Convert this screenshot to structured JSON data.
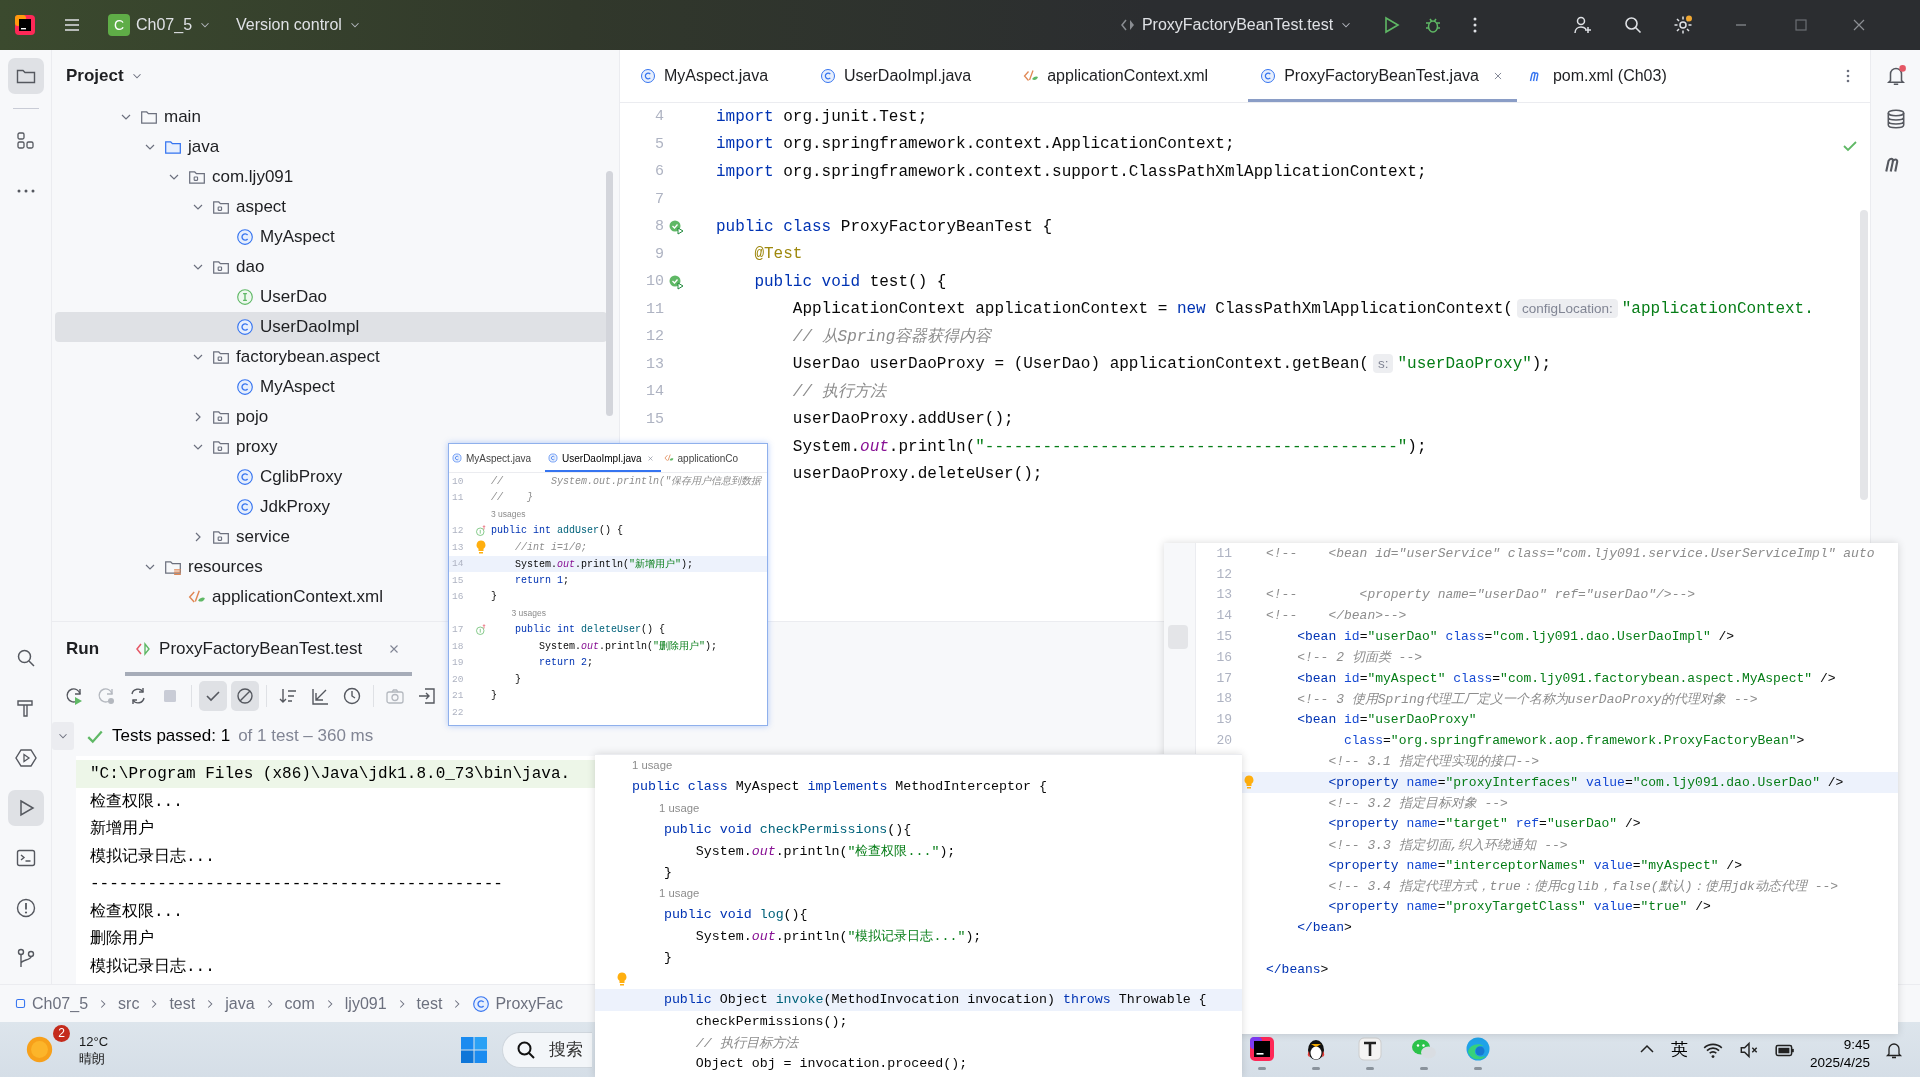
{
  "title_bar": {
    "project_badge": "C",
    "project": "Ch07_5",
    "vcs": "Version control",
    "run_config": "ProxyFactoryBeanTest.test"
  },
  "left_toolbar": {
    "top": [
      {
        "kind": "project",
        "selected": true
      },
      {
        "kind": "structure",
        "selected": false
      },
      {
        "kind": "more",
        "selected": false
      }
    ],
    "bottom": [
      {
        "kind": "search",
        "selected": false
      },
      {
        "kind": "build",
        "selected": false
      },
      {
        "kind": "services",
        "selected": false
      },
      {
        "kind": "run",
        "selected": true
      },
      {
        "kind": "terminal",
        "selected": false
      },
      {
        "kind": "problems",
        "selected": false
      },
      {
        "kind": "git",
        "selected": false
      }
    ]
  },
  "project_panel": {
    "title": "Project",
    "tree": [
      {
        "label": "main",
        "kind": "folder",
        "expanded": true,
        "selected": false,
        "children": [
          {
            "label": "java",
            "kind": "source_root",
            "expanded": true,
            "selected": false,
            "children": [
              {
                "label": "com.ljy091",
                "kind": "package",
                "expanded": true,
                "selected": false,
                "children": [
                  {
                    "label": "aspect",
                    "kind": "package",
                    "expanded": true,
                    "selected": false,
                    "children": [
                      {
                        "label": "MyAspect",
                        "kind": "class",
                        "selected": false
                      }
                    ]
                  },
                  {
                    "label": "dao",
                    "kind": "package",
                    "expanded": true,
                    "selected": false,
                    "children": [
                      {
                        "label": "UserDao",
                        "kind": "interface",
                        "selected": false
                      },
                      {
                        "label": "UserDaoImpl",
                        "kind": "class",
                        "selected": true
                      }
                    ]
                  },
                  {
                    "label": "factorybean.aspect",
                    "kind": "package",
                    "expanded": true,
                    "selected": false,
                    "children": [
                      {
                        "label": "MyAspect",
                        "kind": "class",
                        "selected": false
                      }
                    ]
                  },
                  {
                    "label": "pojo",
                    "kind": "package",
                    "expanded": false,
                    "selected": false
                  },
                  {
                    "label": "proxy",
                    "kind": "package",
                    "expanded": true,
                    "selected": false,
                    "children": [
                      {
                        "label": "CglibProxy",
                        "kind": "class",
                        "selected": false
                      },
                      {
                        "label": "JdkProxy",
                        "kind": "class",
                        "selected": false
                      }
                    ]
                  },
                  {
                    "label": "service",
                    "kind": "package",
                    "expanded": false,
                    "selected": false
                  }
                ]
              }
            ]
          },
          {
            "label": "resources",
            "kind": "resources",
            "expanded": true,
            "selected": false,
            "children": [
              {
                "label": "applicationContext.xml",
                "kind": "xml",
                "selected": false
              }
            ]
          }
        ]
      }
    ]
  },
  "editor": {
    "tabs": [
      {
        "label": "MyAspect.java",
        "kind": "class",
        "selected": false
      },
      {
        "label": "UserDaoImpl.java",
        "kind": "class",
        "selected": false
      },
      {
        "label": "applicationContext.xml",
        "kind": "xml",
        "selected": false
      },
      {
        "label": "ProxyFactoryBeanTest.java",
        "kind": "class",
        "selected": true
      },
      {
        "label": "pom.xml (Ch03)",
        "kind": "maven",
        "selected": false
      }
    ],
    "lines": [
      {
        "kind": "code",
        "number": "4",
        "current": false,
        "segments": [
          {
            "kind": "keyword",
            "text": "import"
          },
          {
            "kind": "plain",
            "text": " org.junit.Test;"
          }
        ]
      },
      {
        "kind": "code",
        "number": "5",
        "current": false,
        "segments": [
          {
            "kind": "keyword",
            "text": "import"
          },
          {
            "kind": "plain",
            "text": " org.springframework.context.ApplicationContext;"
          }
        ]
      },
      {
        "kind": "code",
        "number": "6",
        "current": false,
        "segments": [
          {
            "kind": "keyword",
            "text": "import"
          },
          {
            "kind": "plain",
            "text": " org.springframework.context.support.ClassPathXmlApplicationContext;"
          }
        ]
      },
      {
        "kind": "code",
        "number": "7",
        "current": false
      },
      {
        "kind": "code",
        "number": "8",
        "gutter": {
          "kind": "run"
        },
        "current": false,
        "segments": [
          {
            "kind": "keyword",
            "text": "public class"
          },
          {
            "kind": "plain",
            "text": " ProxyFactoryBeanTest {"
          }
        ]
      },
      {
        "kind": "code",
        "number": "9",
        "current": false,
        "segments": [
          {
            "kind": "annotation",
            "text": "    @Test"
          }
        ]
      },
      {
        "kind": "code",
        "number": "10",
        "gutter": {
          "kind": "run"
        },
        "current": false,
        "segments": [
          {
            "kind": "keyword",
            "text": "    public void"
          },
          {
            "kind": "plain",
            "text": " test() {"
          }
        ]
      },
      {
        "kind": "code",
        "number": "11",
        "current": false,
        "segments": [
          {
            "kind": "plain",
            "text": "        ApplicationContext applicationContext = "
          },
          {
            "kind": "keyword",
            "text": "new"
          },
          {
            "kind": "plain",
            "text": " ClassPathXmlApplicationContext("
          },
          {
            "kind": "hint",
            "text": "configLocation:"
          },
          {
            "kind": "string",
            "text": "\"applicationContext."
          }
        ]
      },
      {
        "kind": "code",
        "number": "12",
        "current": false,
        "segments": [
          {
            "kind": "comment",
            "text": "        // 从Spring容器获得内容"
          }
        ]
      },
      {
        "kind": "code",
        "number": "13",
        "current": false,
        "segments": [
          {
            "kind": "plain",
            "text": "        UserDao userDaoProxy = (UserDao) applicationContext.getBean("
          },
          {
            "kind": "hint",
            "text": "s:"
          },
          {
            "kind": "string",
            "text": "\"userDaoProxy\""
          },
          {
            "kind": "plain",
            "text": ");"
          }
        ]
      },
      {
        "kind": "code",
        "number": "14",
        "current": false,
        "segments": [
          {
            "kind": "comment",
            "text": "        // 执行方法"
          }
        ]
      },
      {
        "kind": "code",
        "number": "15",
        "current": false,
        "segments": [
          {
            "kind": "plain",
            "text": "        userDaoProxy.addUser();"
          }
        ]
      },
      {
        "kind": "code",
        "current": false,
        "segments": [
          {
            "kind": "plain",
            "text": "        System."
          },
          {
            "kind": "field",
            "text": "out"
          },
          {
            "kind": "plain",
            "text": ".println("
          },
          {
            "kind": "string",
            "text": "\"-------------------------------------------\""
          },
          {
            "kind": "plain",
            "text": ");"
          }
        ]
      },
      {
        "kind": "code",
        "current": false,
        "segments": [
          {
            "kind": "plain",
            "text": "        userDaoProxy.deleteUser();"
          }
        ]
      }
    ]
  },
  "run_panel": {
    "title": "Run",
    "tab": {
      "label": "ProxyFactoryBeanTest.test",
      "selected": true
    },
    "toolbar": [
      {
        "kind": "rerun",
        "selected": false,
        "disabled": false
      },
      {
        "kind": "rerun_failed",
        "selected": false,
        "disabled": true
      },
      {
        "kind": "toggle_auto",
        "selected": false,
        "disabled": false
      },
      {
        "kind": "stop",
        "selected": false,
        "disabled": true
      },
      {
        "kind": "show_passed",
        "selected": true,
        "disabled": false
      },
      {
        "kind": "show_ignored",
        "selected": true,
        "disabled": false
      },
      {
        "kind": "sort",
        "selected": false,
        "disabled": false
      },
      {
        "kind": "import",
        "selected": false,
        "disabled": false
      },
      {
        "kind": "history",
        "selected": false,
        "disabled": false
      },
      {
        "kind": "screenshot",
        "selected": false,
        "disabled": true
      },
      {
        "kind": "export",
        "selected": false,
        "disabled": false
      }
    ],
    "result": {
      "summary": "Tests passed: 1",
      "detail": "of 1 test – 360 ms"
    },
    "console": [
      {
        "kind": "command",
        "text": "\"C:\\Program Files (x86)\\Java\\jdk1.8.0_73\\bin\\java."
      },
      {
        "kind": "output",
        "text": "检查权限..."
      },
      {
        "kind": "output",
        "text": "新增用户"
      },
      {
        "kind": "output",
        "text": "模拟记录日志..."
      },
      {
        "kind": "output",
        "text": "-------------------------------------------"
      },
      {
        "kind": "output",
        "text": "检查权限..."
      },
      {
        "kind": "output",
        "text": "删除用户"
      },
      {
        "kind": "output",
        "text": "模拟记录日志..."
      }
    ]
  },
  "breadcrumb": [
    {
      "label": "Ch07_5",
      "kind": "module"
    },
    {
      "label": "src",
      "kind": "folder"
    },
    {
      "label": "test",
      "kind": "folder"
    },
    {
      "label": "java",
      "kind": "folder"
    },
    {
      "label": "com",
      "kind": "folder"
    },
    {
      "label": "ljy091",
      "kind": "folder"
    },
    {
      "label": "test",
      "kind": "folder"
    },
    {
      "label": "ProxyFac",
      "kind": "class"
    }
  ],
  "implementation_snippet": {
    "tabs": [
      {
        "label": "MyAspect.java",
        "kind": "class",
        "selected": false
      },
      {
        "label": "UserDaoImpl.java",
        "kind": "class",
        "selected": true
      },
      {
        "label": "applicationCo",
        "kind": "xml",
        "selected": false
      }
    ],
    "lines": [
      {
        "kind": "code",
        "number": "10",
        "current": false,
        "segments": [
          {
            "kind": "comment",
            "text": "//        System.out.println(\"保存用户信息到数据"
          }
        ]
      },
      {
        "kind": "code",
        "number": "11",
        "current": false,
        "segments": [
          {
            "kind": "comment",
            "text": "//    }"
          }
        ]
      },
      {
        "kind": "usage",
        "text": "3 usages"
      },
      {
        "kind": "code",
        "number": "12",
        "gutter": {
          "kind": "implements"
        },
        "current": false,
        "segments": [
          {
            "kind": "keyword",
            "text": "public int"
          },
          {
            "kind": "method",
            "text": " addUser"
          },
          {
            "kind": "plain",
            "text": "() {"
          }
        ]
      },
      {
        "kind": "code",
        "number": "13",
        "gutter": {
          "kind": "bulb"
        },
        "current": false,
        "segments": [
          {
            "kind": "comment",
            "text": "    //int i=1/0;"
          }
        ]
      },
      {
        "kind": "code",
        "number": "14",
        "current": true,
        "segments": [
          {
            "kind": "plain",
            "text": "    System."
          },
          {
            "kind": "field",
            "text": "out"
          },
          {
            "kind": "plain",
            "text": ".println("
          },
          {
            "kind": "string",
            "text": "\"新增用户\""
          },
          {
            "kind": "plain",
            "text": ");"
          }
        ]
      },
      {
        "kind": "code",
        "number": "15",
        "current": false,
        "segments": [
          {
            "kind": "keyword",
            "text": "    return"
          },
          {
            "kind": "keyword",
            "text": " 1"
          },
          {
            "kind": "plain",
            "text": ";"
          }
        ]
      },
      {
        "kind": "code",
        "number": "16",
        "current": false,
        "segments": [
          {
            "kind": "plain",
            "text": "}"
          }
        ]
      },
      {
        "kind": "usage",
        "text": "3 usages"
      },
      {
        "kind": "code",
        "number": "17",
        "gutter": {
          "kind": "implements"
        },
        "current": false,
        "segments": [
          {
            "kind": "keyword",
            "text": "    public int"
          },
          {
            "kind": "method",
            "text": " deleteUser"
          },
          {
            "kind": "plain",
            "text": "() {"
          }
        ]
      },
      {
        "kind": "code",
        "number": "18",
        "current": false,
        "segments": [
          {
            "kind": "plain",
            "text": "        System."
          },
          {
            "kind": "field",
            "text": "out"
          },
          {
            "kind": "plain",
            "text": ".println("
          },
          {
            "kind": "string",
            "text": "\"删除用户\""
          },
          {
            "kind": "plain",
            "text": ");"
          }
        ]
      },
      {
        "kind": "code",
        "number": "19",
        "current": false,
        "segments": [
          {
            "kind": "keyword",
            "text": "        return"
          },
          {
            "kind": "keyword",
            "text": " 2"
          },
          {
            "kind": "plain",
            "text": ";"
          }
        ]
      },
      {
        "kind": "code",
        "number": "20",
        "current": false,
        "segments": [
          {
            "kind": "plain",
            "text": "    }"
          }
        ]
      },
      {
        "kind": "code",
        "number": "21",
        "current": false,
        "segments": [
          {
            "kind": "plain",
            "text": "}"
          }
        ]
      },
      {
        "kind": "code",
        "number": "22",
        "current": false
      }
    ]
  },
  "xml_snippet": {
    "lines": [
      {
        "kind": "code",
        "number": "11",
        "current": false,
        "segments": [
          {
            "kind": "comment",
            "text": "<!--    <bean id=\"userService\" class=\"com.ljy091.service.UserServiceImpl\" auto"
          }
        ]
      },
      {
        "kind": "code",
        "number": "12",
        "current": false
      },
      {
        "kind": "code",
        "number": "13",
        "current": false,
        "segments": [
          {
            "kind": "comment",
            "text": "<!--        <property name=\"userDao\" ref=\"userDao\"/>-->"
          }
        ]
      },
      {
        "kind": "code",
        "number": "14",
        "current": false,
        "segments": [
          {
            "kind": "comment",
            "text": "<!--    </bean>-->"
          }
        ]
      },
      {
        "kind": "code",
        "number": "15",
        "current": false,
        "segments": [
          {
            "kind": "tag",
            "text": "    <bean"
          },
          {
            "kind": "attribute",
            "text": " id"
          },
          {
            "kind": "plain",
            "text": "="
          },
          {
            "kind": "value",
            "text": "\"userDao\""
          },
          {
            "kind": "attribute",
            "text": " class"
          },
          {
            "kind": "plain",
            "text": "="
          },
          {
            "kind": "value",
            "text": "\"com.ljy091.dao.UserDaoImpl\""
          },
          {
            "kind": "plain",
            "text": " />"
          }
        ]
      },
      {
        "kind": "code",
        "number": "16",
        "current": false,
        "segments": [
          {
            "kind": "comment",
            "text": "    <!-- 2 切面类 -->"
          }
        ]
      },
      {
        "kind": "code",
        "number": "17",
        "current": false,
        "segments": [
          {
            "kind": "tag",
            "text": "    <bean"
          },
          {
            "kind": "attribute",
            "text": " id"
          },
          {
            "kind": "plain",
            "text": "="
          },
          {
            "kind": "value",
            "text": "\"myAspect\""
          },
          {
            "kind": "attribute",
            "text": " class"
          },
          {
            "kind": "plain",
            "text": "="
          },
          {
            "kind": "value",
            "text": "\"com.ljy091.factorybean.aspect.MyAspect\""
          },
          {
            "kind": "plain",
            "text": " />"
          }
        ]
      },
      {
        "kind": "code",
        "number": "18",
        "current": false,
        "segments": [
          {
            "kind": "comment",
            "text": "    <!-- 3 使用Spring代理工厂定义一个名称为userDaoProxy的代理对象 -->"
          }
        ]
      },
      {
        "kind": "code",
        "number": "19",
        "current": false,
        "segments": [
          {
            "kind": "tag",
            "text": "    <bean"
          },
          {
            "kind": "attribute",
            "text": " id"
          },
          {
            "kind": "plain",
            "text": "="
          },
          {
            "kind": "value",
            "text": "\"userDaoProxy\""
          }
        ]
      },
      {
        "kind": "code",
        "number": "20",
        "current": false,
        "segments": [
          {
            "kind": "attribute",
            "text": "          class"
          },
          {
            "kind": "plain",
            "text": "="
          },
          {
            "kind": "value",
            "text": "\"org.springframework.aop.framework.ProxyFactoryBean\""
          },
          {
            "kind": "plain",
            "text": ">"
          }
        ]
      },
      {
        "kind": "code",
        "current": false,
        "segments": [
          {
            "kind": "comment",
            "text": "        <!-- 3.1 指定代理实现的接口-->"
          }
        ]
      },
      {
        "kind": "code",
        "gutter": {
          "kind": "bulb"
        },
        "current": true,
        "segments": [
          {
            "kind": "tag",
            "text": "        <property"
          },
          {
            "kind": "attribute",
            "text": " name"
          },
          {
            "kind": "plain",
            "text": "="
          },
          {
            "kind": "value",
            "text": "\"proxyInterfaces\""
          },
          {
            "kind": "attribute",
            "text": " value"
          },
          {
            "kind": "plain",
            "text": "="
          },
          {
            "kind": "value",
            "text": "\"com.ljy091.dao.UserDao\""
          },
          {
            "kind": "plain",
            "text": " />"
          }
        ]
      },
      {
        "kind": "code",
        "current": false,
        "segments": [
          {
            "kind": "comment",
            "text": "        <!-- 3.2 指定目标对象 -->"
          }
        ]
      },
      {
        "kind": "code",
        "current": false,
        "segments": [
          {
            "kind": "tag",
            "text": "        <property"
          },
          {
            "kind": "attribute",
            "text": " name"
          },
          {
            "kind": "plain",
            "text": "="
          },
          {
            "kind": "value",
            "text": "\"target\""
          },
          {
            "kind": "attribute",
            "text": " ref"
          },
          {
            "kind": "plain",
            "text": "="
          },
          {
            "kind": "value",
            "text": "\"userDao\""
          },
          {
            "kind": "plain",
            "text": " />"
          }
        ]
      },
      {
        "kind": "code",
        "current": false,
        "segments": [
          {
            "kind": "comment",
            "text": "        <!-- 3.3 指定切面,织入环绕通知 -->"
          }
        ]
      },
      {
        "kind": "code",
        "current": false,
        "segments": [
          {
            "kind": "tag",
            "text": "        <property"
          },
          {
            "kind": "attribute",
            "text": " name"
          },
          {
            "kind": "plain",
            "text": "="
          },
          {
            "kind": "value",
            "text": "\"interceptorNames\""
          },
          {
            "kind": "attribute",
            "text": " value"
          },
          {
            "kind": "plain",
            "text": "="
          },
          {
            "kind": "value",
            "text": "\"myAspect\""
          },
          {
            "kind": "plain",
            "text": " />"
          }
        ]
      },
      {
        "kind": "code",
        "current": false,
        "segments": [
          {
            "kind": "comment",
            "text": "        <!-- 3.4 指定代理方式，true：使用cglib，false(默认)：使用jdk动态代理 -->"
          }
        ]
      },
      {
        "kind": "code",
        "current": false,
        "segments": [
          {
            "kind": "tag",
            "text": "        <property"
          },
          {
            "kind": "attribute",
            "text": " name"
          },
          {
            "kind": "plain",
            "text": "="
          },
          {
            "kind": "value",
            "text": "\"proxyTargetClass\""
          },
          {
            "kind": "attribute",
            "text": " value"
          },
          {
            "kind": "plain",
            "text": "="
          },
          {
            "kind": "value",
            "text": "\"true\""
          },
          {
            "kind": "plain",
            "text": " />"
          }
        ]
      },
      {
        "kind": "code",
        "current": false,
        "segments": [
          {
            "kind": "tag",
            "text": "    </bean"
          },
          {
            "kind": "plain",
            "text": ">"
          }
        ]
      },
      {
        "kind": "code",
        "current": false
      },
      {
        "kind": "code",
        "current": false,
        "segments": [
          {
            "kind": "tag",
            "text": "</beans"
          },
          {
            "kind": "plain",
            "text": ">"
          }
        ]
      }
    ]
  },
  "aspect_snippet": {
    "lines": [
      {
        "kind": "usage",
        "text": "1 usage"
      },
      {
        "kind": "code",
        "current": false,
        "segments": [
          {
            "kind": "keyword",
            "text": "public class"
          },
          {
            "kind": "plain",
            "text": " MyAspect "
          },
          {
            "kind": "keyword",
            "text": "implements"
          },
          {
            "kind": "plain",
            "text": " MethodInterceptor {"
          }
        ]
      },
      {
        "kind": "usage",
        "text": "1 usage"
      },
      {
        "kind": "code",
        "current": false,
        "segments": [
          {
            "kind": "keyword",
            "text": "    public void"
          },
          {
            "kind": "method",
            "text": " checkPermissions"
          },
          {
            "kind": "plain",
            "text": "(){"
          }
        ]
      },
      {
        "kind": "code",
        "current": false,
        "segments": [
          {
            "kind": "plain",
            "text": "        System."
          },
          {
            "kind": "field",
            "text": "out"
          },
          {
            "kind": "plain",
            "text": ".println("
          },
          {
            "kind": "string",
            "text": "\"检查权限...\""
          },
          {
            "kind": "plain",
            "text": ");"
          }
        ]
      },
      {
        "kind": "code",
        "current": false,
        "segments": [
          {
            "kind": "plain",
            "text": "    }"
          }
        ]
      },
      {
        "kind": "usage",
        "text": "1 usage"
      },
      {
        "kind": "code",
        "current": false,
        "segments": [
          {
            "kind": "keyword",
            "text": "    public void"
          },
          {
            "kind": "method",
            "text": " log"
          },
          {
            "kind": "plain",
            "text": "(){"
          }
        ]
      },
      {
        "kind": "code",
        "current": false,
        "segments": [
          {
            "kind": "plain",
            "text": "        System."
          },
          {
            "kind": "field",
            "text": "out"
          },
          {
            "kind": "plain",
            "text": ".println("
          },
          {
            "kind": "string",
            "text": "\"模拟记录日志...\""
          },
          {
            "kind": "plain",
            "text": ");"
          }
        ]
      },
      {
        "kind": "code",
        "current": false,
        "segments": [
          {
            "kind": "plain",
            "text": "    }"
          }
        ]
      },
      {
        "kind": "code",
        "gutter": {
          "kind": "bulb"
        },
        "current": false
      },
      {
        "kind": "code",
        "current": true,
        "segments": [
          {
            "kind": "keyword",
            "text": "    public"
          },
          {
            "kind": "plain",
            "text": " Object "
          },
          {
            "kind": "method",
            "text": "invoke"
          },
          {
            "kind": "plain",
            "text": "(MethodInvocation invocation) "
          },
          {
            "kind": "keyword",
            "text": "throws"
          },
          {
            "kind": "plain",
            "text": " Throwable {"
          }
        ]
      },
      {
        "kind": "code",
        "current": false,
        "segments": [
          {
            "kind": "plain",
            "text": "        checkPermissions();"
          }
        ]
      },
      {
        "kind": "code",
        "current": false,
        "segments": [
          {
            "kind": "comment",
            "text": "        // 执行目标方法"
          }
        ]
      },
      {
        "kind": "code",
        "current": false,
        "segments": [
          {
            "kind": "plain",
            "text": "        Object obj = invocation.proceed();"
          }
        ]
      }
    ]
  },
  "taskbar": {
    "weather": {
      "badge": "2",
      "temperature": "12°C",
      "condition": "晴朗"
    },
    "search": {
      "placeholder": "搜索"
    },
    "apps": [
      {
        "kind": "ide"
      },
      {
        "kind": "penguin"
      },
      {
        "kind": "text"
      },
      {
        "kind": "chat"
      },
      {
        "kind": "browser"
      }
    ],
    "input_method": "英",
    "time": "9:45",
    "date": "2025/4/25"
  }
}
